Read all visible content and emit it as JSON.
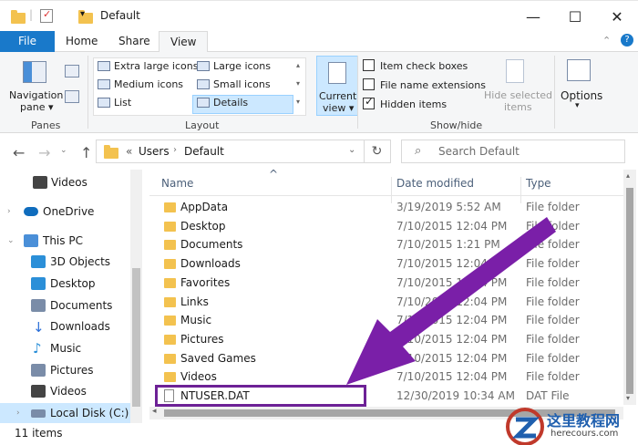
{
  "window": {
    "title": "Default",
    "controls": {
      "minimize": "—",
      "maximize": "☐",
      "close": "✕"
    }
  },
  "ribbon_tabs": [
    "File",
    "Home",
    "Share",
    "View"
  ],
  "ribbon": {
    "panes": {
      "navigation_pane_line1": "Navigation",
      "navigation_pane_line2": "pane",
      "group_label": "Panes"
    },
    "layout": {
      "options": [
        "Extra large icons",
        "Large icons",
        "Medium icons",
        "Small icons",
        "List",
        "Details"
      ],
      "selected": "Details",
      "group_label": "Layout"
    },
    "current_view": {
      "line1": "Current",
      "line2": "view"
    },
    "show_hide": {
      "item_check_boxes": "Item check boxes",
      "file_name_extensions": "File name extensions",
      "hidden_items": "Hidden items",
      "hidden_items_checked": true,
      "hide_selected_line1": "Hide selected",
      "hide_selected_line2": "items",
      "group_label": "Show/hide"
    },
    "options_label": "Options"
  },
  "address": {
    "prefix": "«",
    "crumbs": [
      "Users",
      "Default"
    ],
    "search_placeholder": "Search Default"
  },
  "nav_pane": {
    "items": [
      {
        "label": "Videos",
        "icon": "video-icon",
        "color": "#444444"
      },
      {
        "label": "OneDrive",
        "icon": "cloud-icon",
        "color": "#0f6cbd"
      },
      {
        "label": "This PC",
        "icon": "computer-icon",
        "color": "#4a8fd8"
      },
      {
        "label": "3D Objects",
        "icon": "cube-icon",
        "color": "#2b8fd8"
      },
      {
        "label": "Desktop",
        "icon": "desktop-icon",
        "color": "#2b8fd8"
      },
      {
        "label": "Documents",
        "icon": "document-icon",
        "color": "#7a8ca8"
      },
      {
        "label": "Downloads",
        "icon": "download-icon",
        "color": "#2b6fd8"
      },
      {
        "label": "Music",
        "icon": "music-icon",
        "color": "#2b8fd8"
      },
      {
        "label": "Pictures",
        "icon": "picture-icon",
        "color": "#7a8ca8"
      },
      {
        "label": "Videos",
        "icon": "video-icon",
        "color": "#444444"
      },
      {
        "label": "Local Disk (C:)",
        "icon": "drive-icon",
        "color": "#7a8ca8"
      }
    ]
  },
  "columns": {
    "name": "Name",
    "date": "Date modified",
    "type": "Type"
  },
  "files": [
    {
      "name": "AppData",
      "date": "3/19/2019 5:52 AM",
      "type": "File folder",
      "kind": "folder"
    },
    {
      "name": "Desktop",
      "date": "7/10/2015 12:04 PM",
      "type": "File folder",
      "kind": "folder"
    },
    {
      "name": "Documents",
      "date": "7/10/2015 1:21 PM",
      "type": "File folder",
      "kind": "folder"
    },
    {
      "name": "Downloads",
      "date": "7/10/2015 12:04 PM",
      "type": "File folder",
      "kind": "folder"
    },
    {
      "name": "Favorites",
      "date": "7/10/2015 12:04 PM",
      "type": "File folder",
      "kind": "folder"
    },
    {
      "name": "Links",
      "date": "7/10/2015 12:04 PM",
      "type": "File folder",
      "kind": "folder"
    },
    {
      "name": "Music",
      "date": "7/10/2015 12:04 PM",
      "type": "File folder",
      "kind": "folder"
    },
    {
      "name": "Pictures",
      "date": "7/10/2015 12:04 PM",
      "type": "File folder",
      "kind": "folder"
    },
    {
      "name": "Saved Games",
      "date": "7/10/2015 12:04 PM",
      "type": "File folder",
      "kind": "folder"
    },
    {
      "name": "Videos",
      "date": "7/10/2015 12:04 PM",
      "type": "File folder",
      "kind": "folder"
    },
    {
      "name": "NTUSER.DAT",
      "date": "12/30/2019 10:34 AM",
      "type": "DAT File",
      "kind": "file"
    }
  ],
  "status": {
    "count": "11 items"
  },
  "annotation": {
    "highlight_color": "#6d2196",
    "arrow_color": "#7a1fa8"
  },
  "watermark": {
    "line1": "这里教程网",
    "line2": "herecours.com"
  },
  "colors": {
    "file_tab": "#1979ca",
    "selection": "#cce8ff",
    "folder": "#f3c24f"
  }
}
